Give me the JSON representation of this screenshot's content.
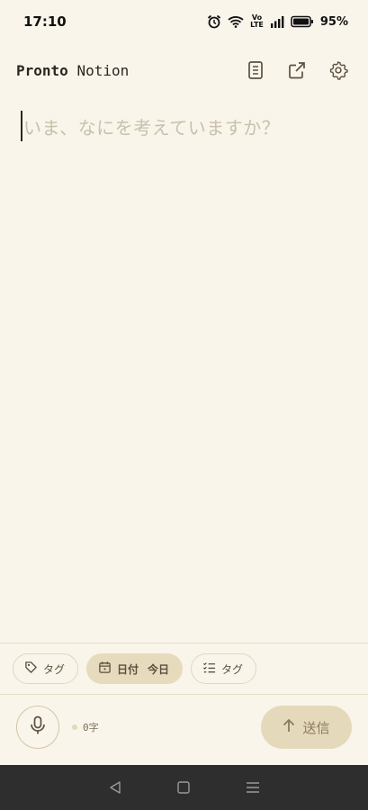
{
  "status_bar": {
    "time": "17:10",
    "network_label_top": "Vo",
    "network_label_bottom": "LTE",
    "battery_percent": "95%",
    "icons": [
      "alarm-icon",
      "wifi-icon",
      "volte-icon",
      "signal-icon",
      "battery-icon"
    ]
  },
  "header": {
    "title_bold": "Pronto",
    "title_rest": "Notion",
    "actions": [
      "document-icon",
      "external-link-icon",
      "settings-icon"
    ]
  },
  "editor": {
    "placeholder": "いま、なにを考えていますか？",
    "value": ""
  },
  "chips": [
    {
      "label": "タグ",
      "icon": "tag-icon"
    },
    {
      "label": "日付",
      "sub": "今日",
      "icon": "calendar-icon",
      "active": true
    },
    {
      "label": "タグ",
      "icon": "checklist-icon"
    }
  ],
  "footer": {
    "char_count": "0字",
    "send_label": "送信",
    "send_icon": "arrow-up-icon",
    "mic_icon": "microphone-icon"
  },
  "system_nav": [
    "back-icon",
    "home-icon",
    "menu-icon"
  ],
  "colors": {
    "background": "#f9f5ea",
    "accent": "#e5d9bb",
    "text": "#2b2620",
    "placeholder": "#c9c0ad",
    "nav_bar": "#2e2e2e"
  }
}
